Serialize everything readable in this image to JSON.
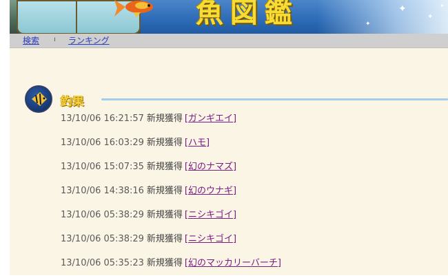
{
  "banner": {
    "title": "魚図鑑"
  },
  "nav": {
    "items": [
      {
        "label": "検索"
      },
      {
        "label": "ランキング"
      }
    ],
    "separator": "ı"
  },
  "section": {
    "title": "釣果"
  },
  "log": [
    {
      "timestamp": "13/10/06 16:21:57",
      "action": "新規獲得",
      "fish": "[ガンギエイ]"
    },
    {
      "timestamp": "13/10/06 16:03:29",
      "action": "新規獲得",
      "fish": "[ハモ]"
    },
    {
      "timestamp": "13/10/06 15:07:35",
      "action": "新規獲得",
      "fish": "[幻のナマズ]"
    },
    {
      "timestamp": "13/10/06 14:38:16",
      "action": "新規獲得",
      "fish": "[幻のウナギ]"
    },
    {
      "timestamp": "13/10/06 05:38:29",
      "action": "新規獲得",
      "fish": "[ニシキゴイ]"
    },
    {
      "timestamp": "13/10/06 05:38:29",
      "action": "新規獲得",
      "fish": "[ニシキゴイ]"
    },
    {
      "timestamp": "13/10/06 05:35:23",
      "action": "新規獲得",
      "fish": "[幻のマッカリーバーチ]"
    }
  ],
  "colors": {
    "background": "#fbf5e6",
    "link": "#2a3dbd",
    "visited_link": "#7a1a82",
    "accent_line": "#9fcdea",
    "title_yellow": "#f6dc35"
  }
}
